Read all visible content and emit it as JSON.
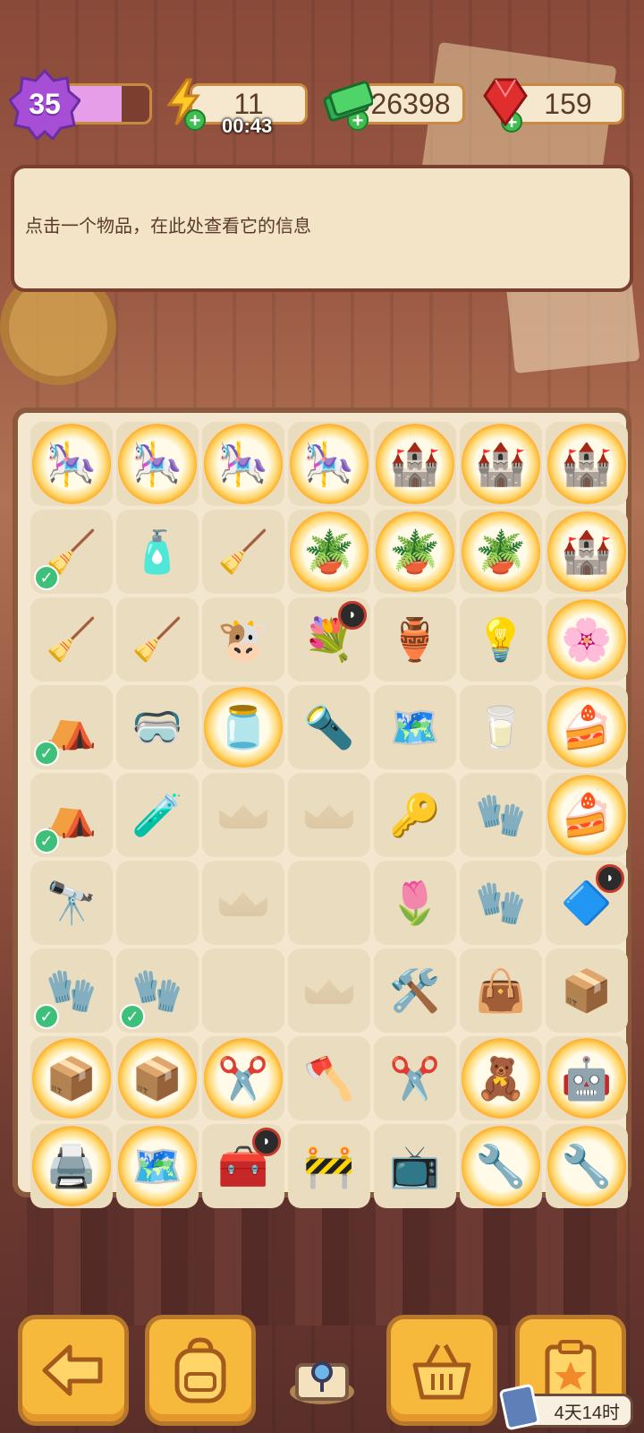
{
  "header": {
    "level": "35",
    "level_progress": 0.7,
    "energy": "11",
    "energy_timer": "00:43",
    "cash": "26398",
    "gems": "159"
  },
  "info_panel": {
    "text": "点击一个物品，在此处查看它的信息"
  },
  "board": {
    "rows": [
      [
        "carousel-orb",
        "carousel-orb",
        "carousel-orb",
        "carousel-orb",
        "castle-orb",
        "castle-orb",
        "castle-orb"
      ],
      [
        "broom-done",
        "spray-bottle",
        "duster",
        "plant-pot-orb",
        "plant-pot-orb",
        "plant-pot-orb",
        "castle-orb"
      ],
      [
        "green-hand-broom",
        "dustpan",
        "yak-mascot",
        "flower-basket-badge",
        "broken-pot",
        "tiffany-lamp",
        "flower-orb"
      ],
      [
        "purple-tent-done",
        "goggles",
        "jar-orb",
        "flashlight",
        "orange-map",
        "glass-mug",
        "cake-orb"
      ],
      [
        "purple-tent-done",
        "green-tube",
        "empty",
        "empty",
        "gold-key",
        "red-glove",
        "cake-orb"
      ],
      [
        "spyglass",
        "blank",
        "empty",
        "blank",
        "tulips",
        "red-gloves",
        "crystal-pyramid-badge"
      ],
      [
        "red-mittens-done",
        "red-mittens-done",
        "blank",
        "empty",
        "trowel",
        "zip-bag",
        "brown-box"
      ],
      [
        "crate-orb",
        "crate-orb",
        "scissors-orb",
        "axe",
        "pruning-shears",
        "toy-orb",
        "robot-orb"
      ],
      [
        "printer-orb",
        "map-orb",
        "workbench-badge",
        "barrier",
        "tv-monster",
        "tools-orb",
        "tools-orb"
      ]
    ]
  },
  "bottom_nav": {
    "event_timer": "4天14时"
  }
}
